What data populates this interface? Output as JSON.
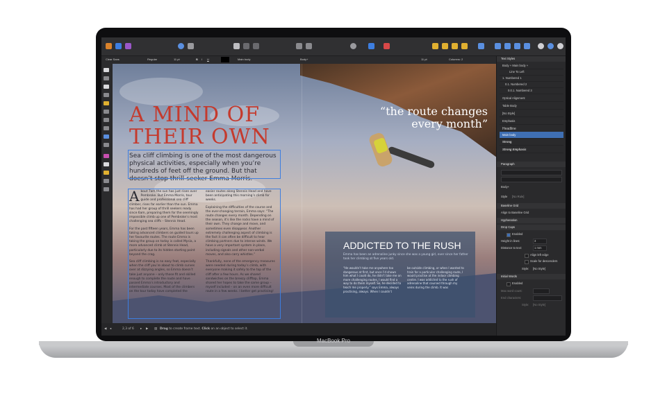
{
  "device": {
    "brand_label": "MacBook Pro"
  },
  "context_bar": {
    "font": "Clear Sans",
    "weight": "Regular",
    "size": "11 pt",
    "para_style": "Main body",
    "char_style": "Body+",
    "leading": "11 pt",
    "columns": "Columns: 2"
  },
  "document": {
    "title_line1": "A MIND OF",
    "title_line2": "THEIR OWN",
    "lede": "Sea cliff climbing is one of the most dangerous physical activities, especially when you’re hundreds of feet off the ground. But that doesn’t stop thrill-seeker Emma Morris.",
    "col1_dropcap": "A",
    "col1_p1": "bout 7am the sun has just risen over Pembroke. But Emma Morris, tour guide and professional sea cliff climber, rises far earlier than the sun. Emma has had her group of thrill seekers ready since 6am, preparing them for the seemingly impossible climb up one of Pembroke’s most challenging sea cliffs – Stennis Head.",
    "col1_p2": "For the past fifteen years, Emma has been taking advanced climbers on guided tours up her favourite routes. The route Emma is taking the group on today is called Mysia, a more advanced climb at Stennis Head, particularly due to its hidden starting point beyond the crag.",
    "col1_p3": "Sea cliff climbing is no easy feat, especially when the cliff you’re about to climb curves over at dizzying angles, so Emma doesn’t take just anyone – only those fit and skilled enough to complete the route and have passed Emma’s introductory and intermediate courses. Most of the climbers on the tour today have completed the",
    "col2_p1": "easier routes along Stennis Head and have been anticipating this morning’s climb for weeks.",
    "col2_p2": "Explaining the difficulties of the course and the ever-changing terrain, Emma says: “The route changes every month. Depending on the season, it’s like the rocks have a mind of their own. They change and move, and sometimes even disappear. Another extremely challenging aspect of climbing is the fact it can often be difficult to hear climbing partners due to intense winds. We have a very important system in place, including signals and other non-verbal moves, and also carry whistles.”",
    "col2_p3": "Thankfully, none of the emergency measures were needed during today’s climb, with everyone making it safely to the top of the cliff after a few hours. As we shared sandwiches on the breezy clifftop, Emma shared her hopes to take the same group – myself included – on an even more difficult route in a few weeks. I better get practising!",
    "pull_quote": "“the route changes every month”",
    "box_title": "ADDICTED TO THE RUSH",
    "box_sub": "Emma has been an adrenaline junky since she was a young girl, ever since her father took her climbing at five years old.",
    "box_col1": "“He wouldn’t take me anywhere too dangerous at first, but once I’d shown him what I could do, he didn’t take me on more challenging routes, I would find a way to do them myself. So, he decided to teach me properly.” says Emma, always practising, always. When I couldn’t",
    "box_col2": "be outside climbing, or when I wanted to train for a particular challenging route, I would practise at the indoor climbing centre. I was addicted to the rush of adrenaline that coursed through my veins during the climb. It was"
  },
  "status_bar": {
    "page": "2,3 of 6",
    "hint_drag": "Drag",
    "hint_rest1": " to create frame text. ",
    "hint_click": "Click",
    "hint_rest2": " on an object to select it."
  },
  "studio": {
    "text_styles_header": "Text Styles",
    "styles": [
      "Body + Main body +",
      "Line To Left",
      "1.   Numbered 1",
      "0.1.   Numbered 2",
      "0.0.1.   Numbered 3",
      "Optical Alignment",
      "Table Body",
      "[No Style]",
      "Emphasis",
      "Headline",
      "Main body",
      "Strong",
      "Strong Emphasis"
    ],
    "selected_style": "Main body",
    "paragraph_header": "Paragraph",
    "para_style_value": "Body+",
    "style_label": "Style",
    "style_value": "[No Rule]",
    "baseline_grid": "Baseline Grid",
    "align_baseline": "Align to Baseline Grid",
    "hyphenation": "Hyphenation",
    "drop_caps": "Drop Caps",
    "enabled": "Enabled",
    "height_label": "Height in lines:",
    "height_value": "3",
    "distance_label": "Distance to text:",
    "distance_value": "1 mm",
    "align_left_edge": "Align left edge",
    "scale_desc": "Scale for descenders",
    "dc_style_label": "Style:",
    "dc_style_value": "[No Style]",
    "initial_words": "Initial Words",
    "iw_enabled": "Enabled",
    "max_word_count": "Max word count:",
    "end_characters": "End characters:",
    "iw_style_label": "Style:",
    "iw_style_value": "[No Style]"
  },
  "colors": {
    "title_red": "#c53a2d",
    "selection_blue": "#3f6fb3"
  }
}
